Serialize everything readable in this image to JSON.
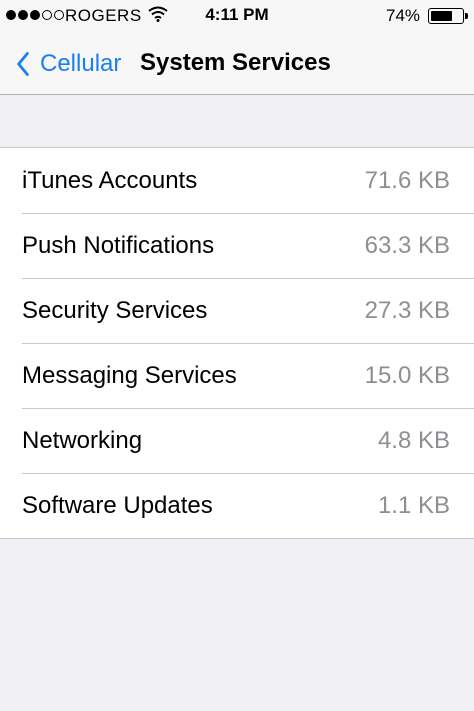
{
  "status_bar": {
    "signal_bars": 3,
    "signal_total": 5,
    "carrier": "ROGERS",
    "wifi_icon": "wifi-icon",
    "time": "4:11 PM",
    "battery_percent_text": "74%",
    "battery_level": 0.74
  },
  "nav": {
    "back_label": "Cellular",
    "back_icon": "chevron-left-icon",
    "title": "System Services",
    "accent_color": "#1a7df4"
  },
  "services": [
    {
      "label": "iTunes Accounts",
      "value": "71.6 KB"
    },
    {
      "label": "Push Notifications",
      "value": "63.3 KB"
    },
    {
      "label": "Security Services",
      "value": "27.3 KB"
    },
    {
      "label": "Messaging Services",
      "value": "15.0 KB"
    },
    {
      "label": "Networking",
      "value": "4.8 KB"
    },
    {
      "label": "Software Updates",
      "value": "1.1 KB"
    }
  ]
}
